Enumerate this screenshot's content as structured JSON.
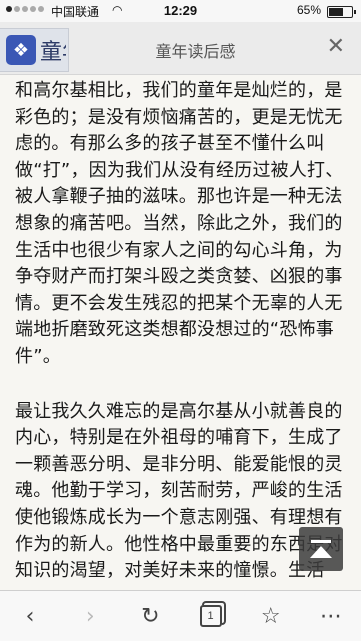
{
  "status_bar": {
    "carrier": "中国联通",
    "time": "12:29",
    "battery_pct": "65%",
    "battery_level": 0.65
  },
  "header": {
    "logo_text": "童年",
    "title": "童年读后感",
    "close_icon": "close-icon"
  },
  "article": {
    "paragraphs": [
      "和高尔基相比，我们的童年是灿烂的，是彩色的；是没有烦恼痛苦的，更是无忧无虑的。有那么多的孩子甚至不懂什么叫做“打”，因为我们从没有经历过被人打、被人拿鞭子抽的滋味。那也许是一种无法想象的痛苦吧。当然，除此之外，我们的生活中也很少有家人之间的勾心斗角，为争夺财产而打架斗殴之类贪婪、凶狠的事情。更不会发生残忍的把某个无辜的人无端地折磨致死这类想都没想过的“恐怖事件”。",
      "最让我久久难忘的是高尔基从小就善良的内心，特别是在外祖母的哺育下，生成了一颗善恶分明、是非分明、能爱能恨的灵魂。他勤于学习，刻苦耐劳，严峻的生活使他锻炼成长为一个意志刚强、有理想有作为的新人。他性格中最重要的东西是对知识的渴望，对美好未来的憧憬。生活"
    ]
  },
  "toolbar": {
    "tab_count": "1",
    "icons": [
      "back-icon",
      "forward-icon",
      "refresh-icon",
      "tabs-icon",
      "favorite-icon",
      "more-icon"
    ]
  },
  "colors": {
    "background": "#f7f6f2",
    "logo_blue": "#3a57b5"
  }
}
